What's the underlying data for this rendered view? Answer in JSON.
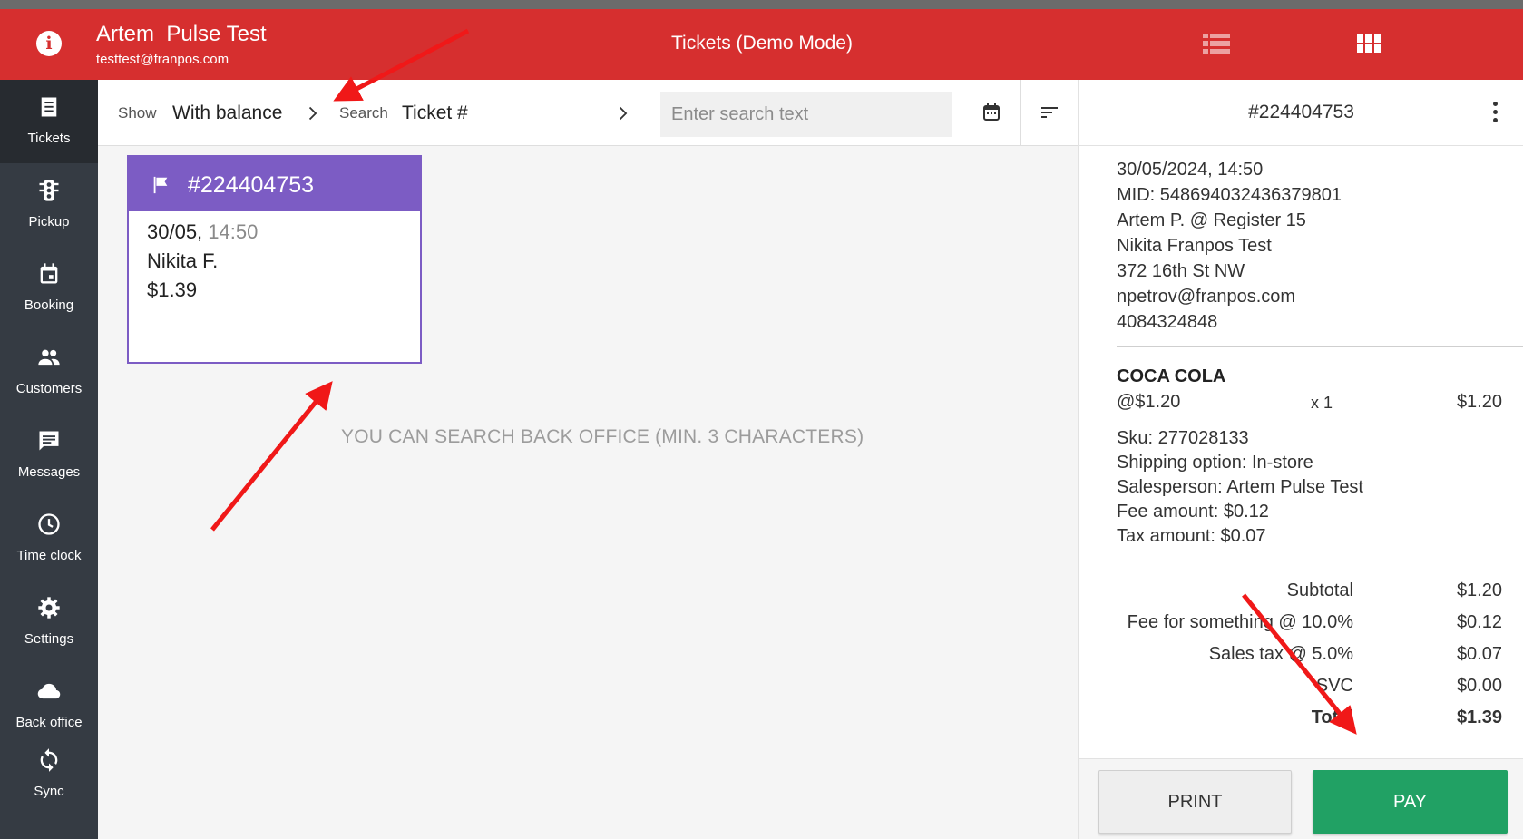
{
  "header": {
    "user_name": "Artem  Pulse Test",
    "user_email": "testtest@franpos.com",
    "title": "Tickets (Demo Mode)",
    "info_icon_glyph": "i"
  },
  "sidebar": {
    "items": [
      {
        "label": "Tickets",
        "icon": "tickets-icon",
        "active": true
      },
      {
        "label": "Pickup",
        "icon": "traffic-light-icon"
      },
      {
        "label": "Booking",
        "icon": "calendar-icon"
      },
      {
        "label": "Customers",
        "icon": "people-icon"
      },
      {
        "label": "Messages",
        "icon": "message-icon"
      },
      {
        "label": "Time clock",
        "icon": "clock-icon"
      },
      {
        "label": "Settings",
        "icon": "gear-icon"
      },
      {
        "label": "Back office",
        "icon": "cloud-icon"
      },
      {
        "label": "Sync",
        "icon": "sync-icon"
      }
    ]
  },
  "toolbar": {
    "show_label": "Show",
    "show_value": "With balance",
    "search_label": "Search",
    "search_value": "Ticket #",
    "search_placeholder": "Enter search text"
  },
  "ticket_card": {
    "number": "#224404753",
    "date": "30/05,",
    "time": "14:50",
    "customer": "Nikita F.",
    "amount": "$1.39"
  },
  "hint": "YOU CAN SEARCH BACK OFFICE (MIN. 3 CHARACTERS)",
  "panel": {
    "ticket_number": "#224404753",
    "details": [
      "30/05/2024, 14:50",
      "MID: 548694032436379801",
      "Artem P. @ Register 15",
      "Nikita Franpos Test",
      "372 16th St NW",
      "npetrov@franpos.com",
      "4084324848"
    ],
    "item": {
      "name": "COCA COLA",
      "unit_price": "@$1.20",
      "qty_sign": "x",
      "qty": "1",
      "line_total": "$1.20",
      "attributes": [
        "Sku: 277028133",
        "Shipping option: In-store",
        "Salesperson: Artem Pulse Test",
        "Fee amount: $0.12",
        "Tax amount: $0.07"
      ]
    },
    "summary": [
      {
        "label": "Subtotal",
        "value": "$1.20"
      },
      {
        "label": "Fee for something @ 10.0%",
        "value": "$0.12"
      },
      {
        "label": "Sales tax @ 5.0%",
        "value": "$0.07"
      },
      {
        "label": "SVC",
        "value": "$0.00"
      },
      {
        "label": "Total",
        "value": "$1.39"
      }
    ],
    "print_label": "PRINT",
    "pay_label": "PAY"
  },
  "colors": {
    "header": "#d62f2f",
    "sidebar": "#353b43",
    "ticket_accent": "#7c5cc4",
    "pay_button": "#21a164",
    "annotation_arrow": "#f01818"
  }
}
